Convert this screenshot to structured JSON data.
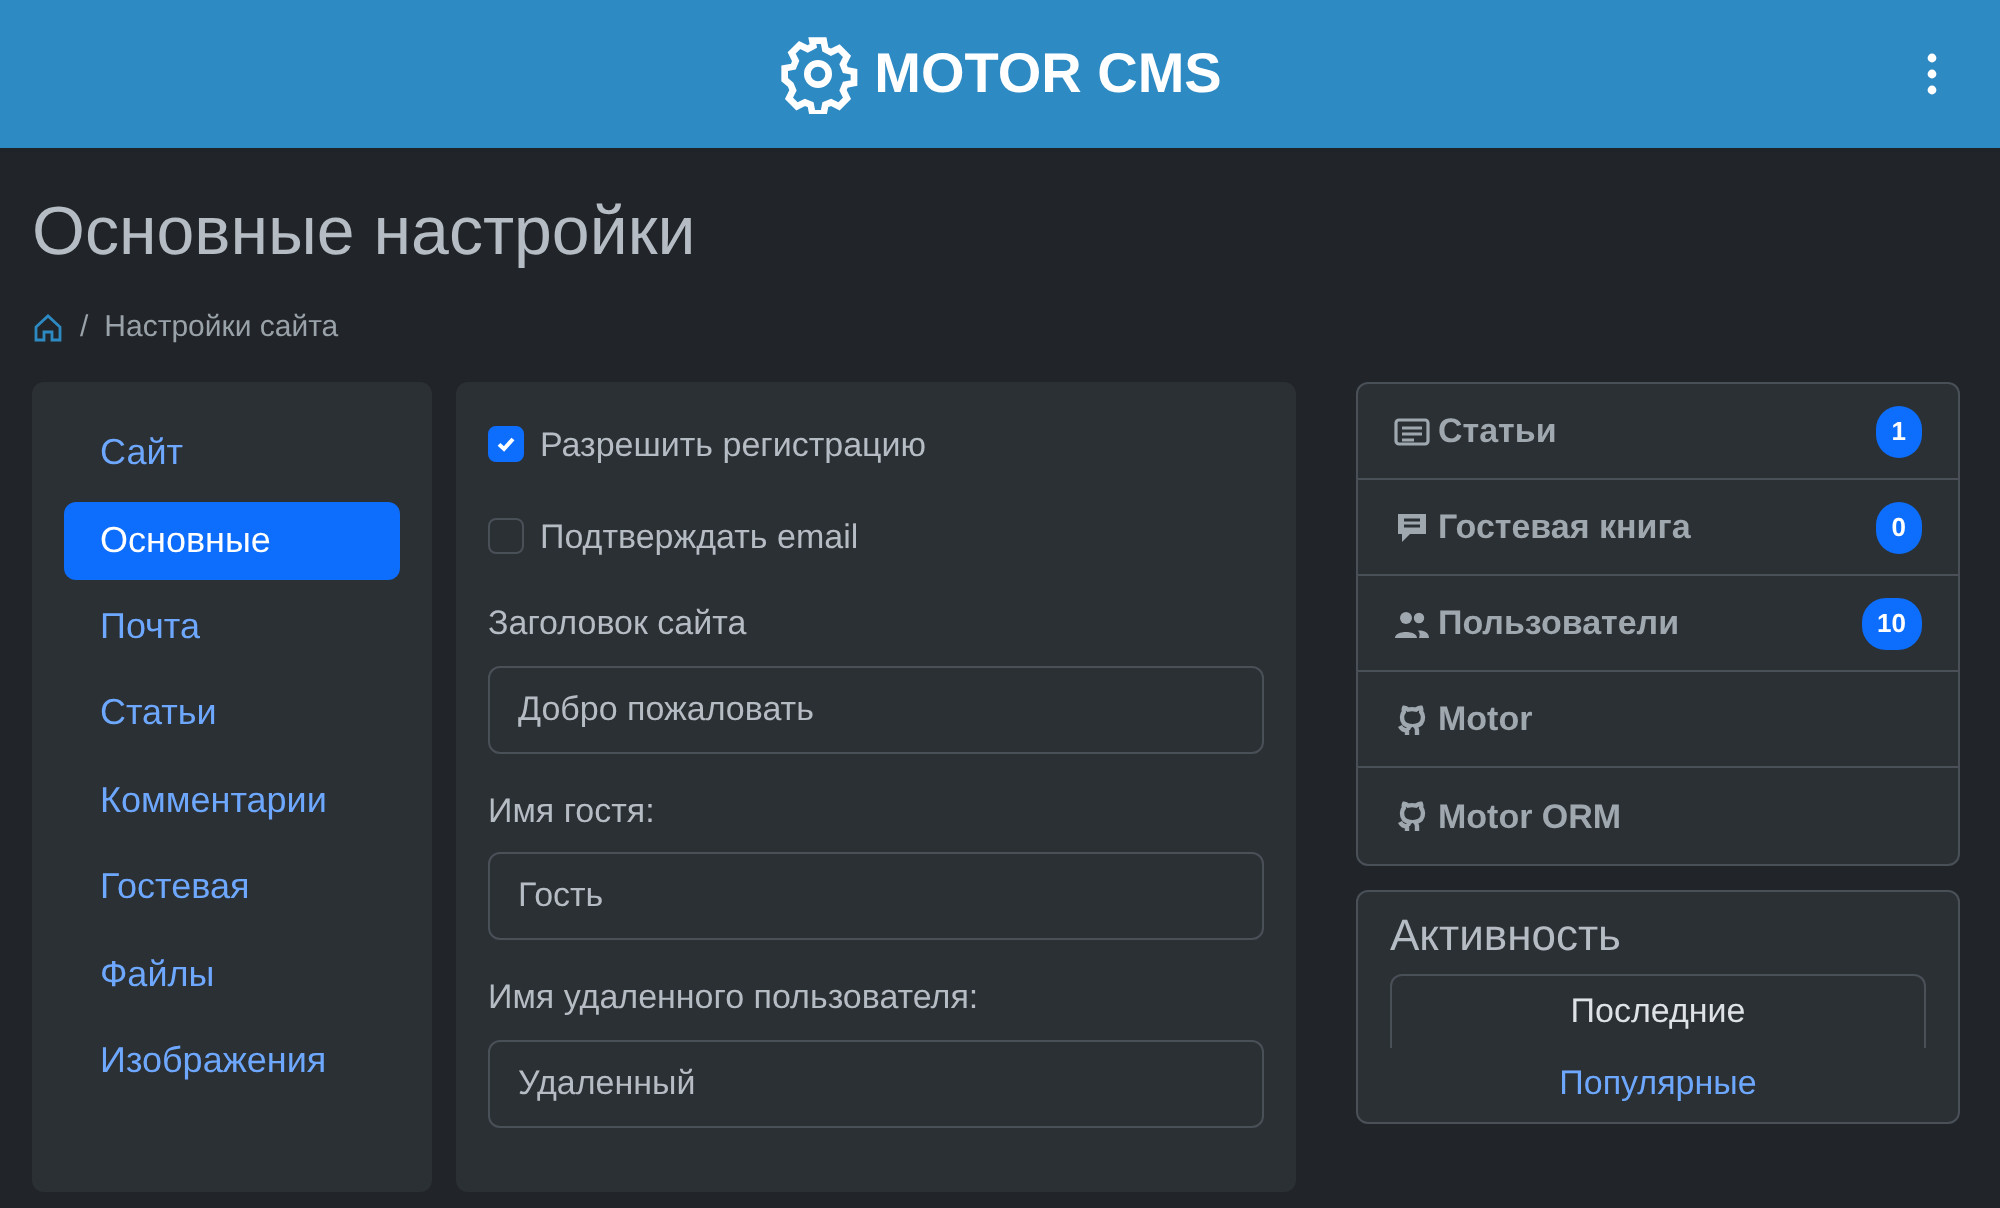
{
  "header": {
    "brand": "MOTOR CMS"
  },
  "page": {
    "title": "Основные настройки",
    "breadcrumb": [
      {
        "separator": "/",
        "label": "Настройки сайта"
      }
    ]
  },
  "sidebar": {
    "items": [
      {
        "label": "Сайт",
        "selected": false
      },
      {
        "label": "Основные",
        "selected": true
      },
      {
        "label": "Почта",
        "selected": false
      },
      {
        "label": "Статьи",
        "selected": false
      },
      {
        "label": "Комментарии",
        "selected": false
      },
      {
        "label": "Гостевая",
        "selected": false
      },
      {
        "label": "Файлы",
        "selected": false
      },
      {
        "label": "Изображения",
        "selected": false
      }
    ]
  },
  "form": {
    "checkboxes": [
      {
        "label": "Разрешить регистрацию",
        "checked": true
      },
      {
        "label": "Подтверждать email",
        "checked": false
      }
    ],
    "fields": [
      {
        "label": "Заголовок сайта",
        "value": "Добро пожаловать"
      },
      {
        "label": "Имя гостя:",
        "value": "Гость"
      },
      {
        "label": "Имя удаленного пользователя:",
        "value": "Удаленный"
      }
    ]
  },
  "links": [
    {
      "kind": "articles",
      "label": "Статьи",
      "count": "1"
    },
    {
      "kind": "guestbook",
      "label": "Гостевая книга",
      "count": "0"
    },
    {
      "kind": "users",
      "label": "Пользователи",
      "count": "10"
    },
    {
      "kind": "github",
      "label": "Motor"
    },
    {
      "kind": "github",
      "label": "Motor ORM"
    }
  ],
  "activity": {
    "title": "Активность",
    "tabs": [
      {
        "label": "Последние",
        "selected": true
      },
      {
        "label": "Популярные",
        "selected": false
      }
    ]
  }
}
